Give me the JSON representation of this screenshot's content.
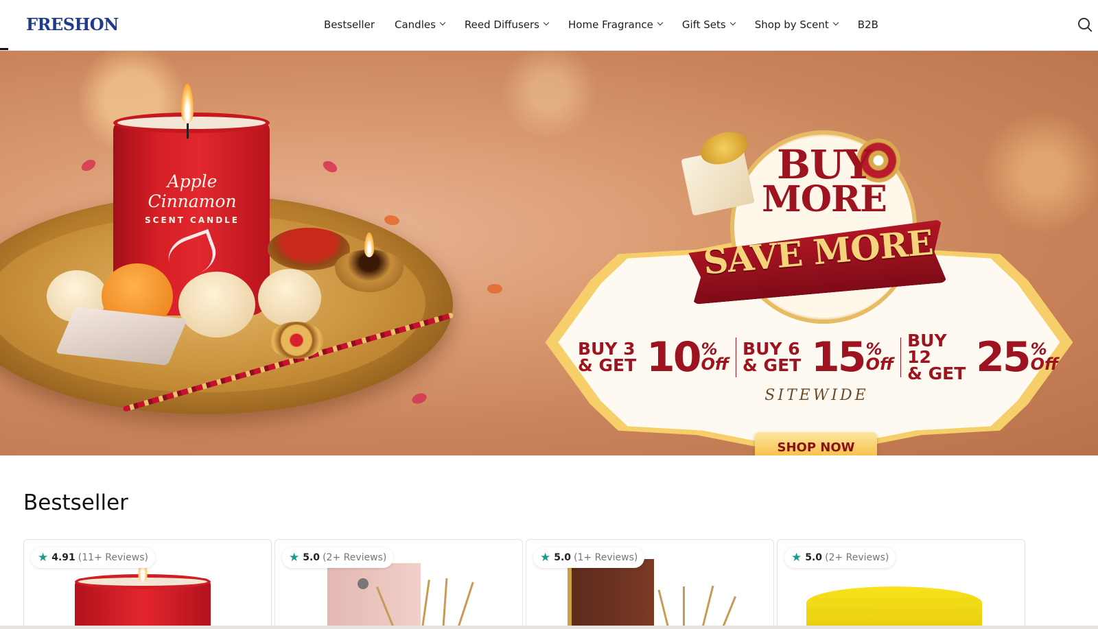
{
  "header": {
    "logo": "FRESHON",
    "nav": [
      {
        "label": "Bestseller",
        "dropdown": false
      },
      {
        "label": "Candles",
        "dropdown": true
      },
      {
        "label": "Reed Diffusers",
        "dropdown": true
      },
      {
        "label": "Home Fragrance",
        "dropdown": true
      },
      {
        "label": "Gift Sets",
        "dropdown": true
      },
      {
        "label": "Shop by Scent",
        "dropdown": true
      },
      {
        "label": "B2B",
        "dropdown": false
      }
    ],
    "search_icon": "search-icon"
  },
  "hero": {
    "candle_name": "Apple Cinnamon",
    "candle_sub": "SCENT CANDLE",
    "headline_1": "BUY",
    "headline_2": "MORE",
    "headline_3": "SAVE MORE",
    "offers": [
      {
        "line1": "BUY 3",
        "line2": "& GET",
        "value": "10",
        "pct": "%",
        "off": "Off"
      },
      {
        "line1": "BUY 6",
        "line2": "& GET",
        "value": "15",
        "pct": "%",
        "off": "Off"
      },
      {
        "line1": "BUY 12",
        "line2": "& GET",
        "value": "25",
        "pct": "%",
        "off": "Off"
      }
    ],
    "sitewide": "SITEWIDE",
    "cta": "SHOP NOW"
  },
  "bestseller": {
    "title": "Bestseller",
    "products": [
      {
        "score": "4.91",
        "reviews": "(11+ Reviews)"
      },
      {
        "score": "5.0",
        "reviews": "(2+ Reviews)"
      },
      {
        "score": "5.0",
        "reviews": "(1+ Reviews)"
      },
      {
        "score": "5.0",
        "reviews": "(2+ Reviews)"
      }
    ]
  },
  "colors": {
    "brand": "#1f3c8c",
    "offer_red": "#9d1420",
    "star": "#1a9c8a",
    "cta_gold": "#f5b52d"
  }
}
